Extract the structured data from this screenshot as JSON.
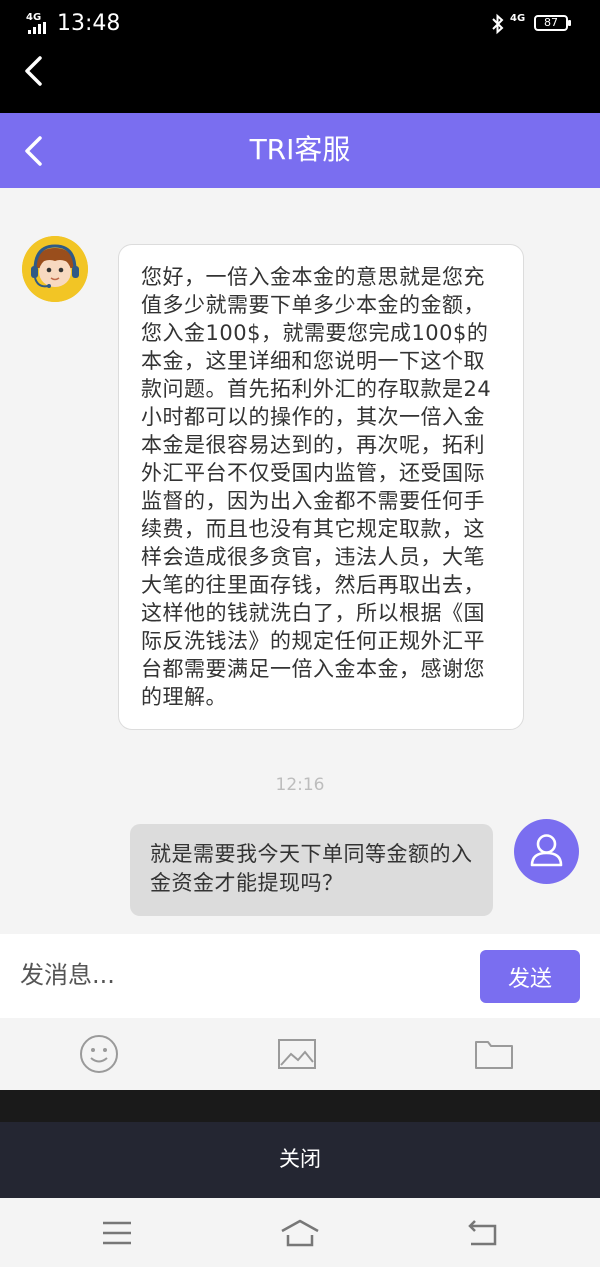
{
  "status_bar": {
    "network_left": "4G",
    "time": "13:48",
    "network_right": "4G",
    "battery": "87"
  },
  "header": {
    "title": "TRI客服"
  },
  "messages": {
    "incoming_text": "您好，一倍入金本金的意思就是您充值多少就需要下单多少本金的金额，您入金100$，就需要您完成100$的本金，这里详细和您说明一下这个取款问题。首先拓利外汇的存取款是24小时都可以的操作的，其次一倍入金本金是很容易达到的，再次呢，拓利外汇平台不仅受国内监管，还受国际监督的，因为出入金都不需要任何手续费，而且也没有其它规定取款，这样会造成很多贪官，违法人员，大笔大笔的往里面存钱，然后再取出去，这样他的钱就洗白了，所以根据《国际反洗钱法》的规定任何正规外汇平台都需要满足一倍入金本金，感谢您的理解。",
    "timestamp": "12:16",
    "outgoing_text": "就是需要我今天下单同等金额的入金资金才能提现吗？"
  },
  "composer": {
    "placeholder": "发消息...",
    "send_label": "发送"
  },
  "close_bar": {
    "label": "关闭"
  },
  "colors": {
    "accent": "#7a6ef0",
    "avatar_bg": "#f2c525"
  },
  "icons": [
    "back-icon",
    "bluetooth-icon",
    "emoji-icon",
    "image-icon",
    "folder-icon",
    "menu-icon",
    "home-icon",
    "return-icon",
    "user-icon"
  ]
}
